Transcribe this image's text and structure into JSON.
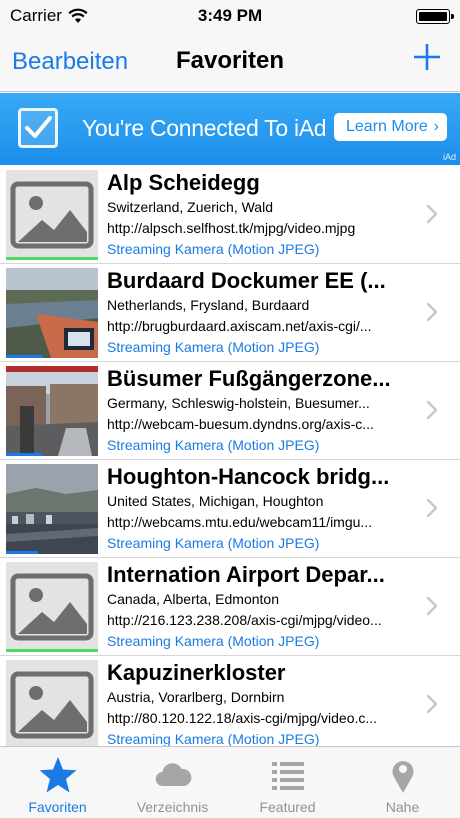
{
  "status": {
    "carrier": "Carrier",
    "time": "3:49 PM"
  },
  "nav": {
    "edit_label": "Bearbeiten",
    "title": "Favoriten",
    "add_icon": "plus-icon"
  },
  "ad": {
    "text": "You're Connected To iAd",
    "learn_more": "Learn More",
    "tag": "iAd"
  },
  "colors": {
    "accent": "#1a7be6",
    "progress": "#4cd964",
    "stream": "#1a7be6"
  },
  "cams": [
    {
      "title": "Alp Scheidegg",
      "location": "Switzerland, Zuerich, Wald",
      "url": "http://alpsch.selfhost.tk/mjpg/video.mjpg",
      "type": "Streaming Kamera (Motion JPEG)",
      "thumb": "placeholder",
      "progress": 1.0
    },
    {
      "title": "Burdaard Dockumer EE (...",
      "location": "Netherlands, Frysland, Burdaard",
      "url": "http://brugburdaard.axiscam.net/axis-cgi/...",
      "type": "Streaming Kamera (Motion JPEG)",
      "thumb": "river",
      "progress": 0.4
    },
    {
      "title": "Büsumer Fußgängerzone...",
      "location": "Germany, Schleswig-holstein, Buesumer...",
      "url": "http://webcam-buesum.dyndns.org/axis-c...",
      "type": "Streaming Kamera (Motion JPEG)",
      "thumb": "street",
      "progress": 0.4
    },
    {
      "title": "Houghton-Hancock bridg...",
      "location": "United States, Michigan, Houghton",
      "url": "http://webcams.mtu.edu/webcam11/imgu...",
      "type": "Streaming Kamera (Motion JPEG)",
      "thumb": "town",
      "progress": 0.35
    },
    {
      "title": "Internation Airport Depar...",
      "location": "Canada, Alberta, Edmonton",
      "url": "http://216.123.238.208/axis-cgi/mjpg/video...",
      "type": "Streaming Kamera (Motion JPEG)",
      "thumb": "placeholder",
      "progress": 1.0
    },
    {
      "title": "Kapuzinerkloster",
      "location": "Austria, Vorarlberg, Dornbirn",
      "url": "http://80.120.122.18/axis-cgi/mjpg/video.c...",
      "type": "Streaming Kamera (Motion JPEG)",
      "thumb": "placeholder",
      "progress": 1.0
    }
  ],
  "tabs": [
    {
      "label": "Favoriten",
      "icon": "star-icon",
      "active": true
    },
    {
      "label": "Verzeichnis",
      "icon": "cloud-icon",
      "active": false
    },
    {
      "label": "Featured",
      "icon": "list-icon",
      "active": false
    },
    {
      "label": "Nahe",
      "icon": "location-pin-icon",
      "active": false
    }
  ]
}
